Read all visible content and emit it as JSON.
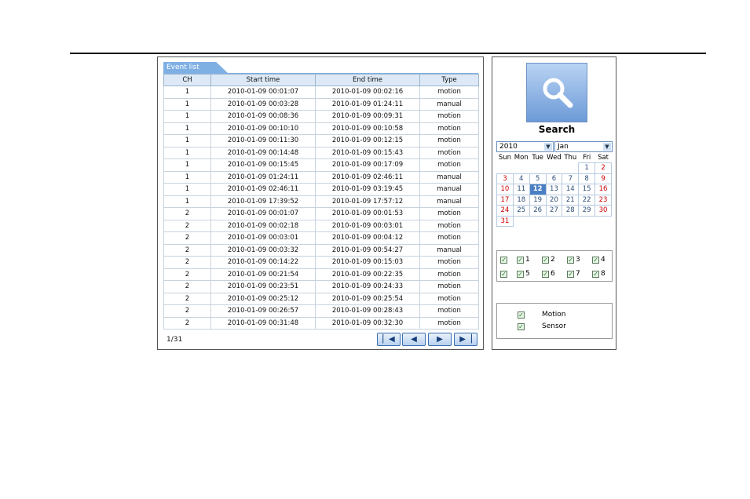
{
  "event_list": {
    "tab_label": "Event list",
    "columns": [
      "CH",
      "Start time",
      "End time",
      "Type"
    ],
    "rows": [
      [
        "1",
        "2010-01-09 00:01:07",
        "2010-01-09 00:02:16",
        "motion"
      ],
      [
        "1",
        "2010-01-09 00:03:28",
        "2010-01-09 01:24:11",
        "manual"
      ],
      [
        "1",
        "2010-01-09 00:08:36",
        "2010-01-09 00:09:31",
        "motion"
      ],
      [
        "1",
        "2010-01-09 00:10:10",
        "2010-01-09 00:10:58",
        "motion"
      ],
      [
        "1",
        "2010-01-09 00:11:30",
        "2010-01-09 00:12:15",
        "motion"
      ],
      [
        "1",
        "2010-01-09 00:14:48",
        "2010-01-09 00:15:43",
        "motion"
      ],
      [
        "1",
        "2010-01-09 00:15:45",
        "2010-01-09 00:17:09",
        "motion"
      ],
      [
        "1",
        "2010-01-09 01:24:11",
        "2010-01-09 02:46:11",
        "manual"
      ],
      [
        "1",
        "2010-01-09 02:46:11",
        "2010-01-09 03:19:45",
        "manual"
      ],
      [
        "1",
        "2010-01-09 17:39:52",
        "2010-01-09 17:57:12",
        "manual"
      ],
      [
        "2",
        "2010-01-09 00:01:07",
        "2010-01-09 00:01:53",
        "motion"
      ],
      [
        "2",
        "2010-01-09 00:02:18",
        "2010-01-09 00:03:01",
        "motion"
      ],
      [
        "2",
        "2010-01-09 00:03:01",
        "2010-01-09 00:04:12",
        "motion"
      ],
      [
        "2",
        "2010-01-09 00:03:32",
        "2010-01-09 00:54:27",
        "manual"
      ],
      [
        "2",
        "2010-01-09 00:14:22",
        "2010-01-09 00:15:03",
        "motion"
      ],
      [
        "2",
        "2010-01-09 00:21:54",
        "2010-01-09 00:22:35",
        "motion"
      ],
      [
        "2",
        "2010-01-09 00:23:51",
        "2010-01-09 00:24:33",
        "motion"
      ],
      [
        "2",
        "2010-01-09 00:25:12",
        "2010-01-09 00:25:54",
        "motion"
      ],
      [
        "2",
        "2010-01-09 00:26:57",
        "2010-01-09 00:28:43",
        "motion"
      ],
      [
        "2",
        "2010-01-09 00:31:48",
        "2010-01-09 00:32:30",
        "motion"
      ]
    ],
    "page_indicator": "1/31",
    "pager": {
      "first": "first-page-icon",
      "prev": "prev-page-icon",
      "next": "next-page-icon",
      "last": "last-page-icon"
    }
  },
  "search": {
    "label": "Search",
    "icon": "magnifier-icon",
    "year": "2010",
    "month": "Jan",
    "selected_day": 12,
    "weekdays": [
      "Sun",
      "Mon",
      "Tue",
      "Wed",
      "Thu",
      "Fri",
      "Sat"
    ],
    "weeks": [
      [
        "",
        "",
        "",
        "",
        "",
        "1",
        "2"
      ],
      [
        "3",
        "4",
        "5",
        "6",
        "7",
        "8",
        "9"
      ],
      [
        "10",
        "11",
        "12",
        "13",
        "14",
        "15",
        "16"
      ],
      [
        "17",
        "18",
        "19",
        "20",
        "21",
        "22",
        "23"
      ],
      [
        "24",
        "25",
        "26",
        "27",
        "28",
        "29",
        "30"
      ],
      [
        "31",
        "",
        "",
        "",
        "",
        "",
        ""
      ]
    ],
    "channels": {
      "all_checked": true,
      "items": [
        {
          "label": "1",
          "checked": true
        },
        {
          "label": "2",
          "checked": true
        },
        {
          "label": "3",
          "checked": true
        },
        {
          "label": "4",
          "checked": true
        },
        {
          "label": "5",
          "checked": true
        },
        {
          "label": "6",
          "checked": true
        },
        {
          "label": "7",
          "checked": true
        },
        {
          "label": "8",
          "checked": true
        }
      ]
    },
    "types": [
      {
        "label": "Motion",
        "checked": true
      },
      {
        "label": "Sensor",
        "checked": true
      }
    ]
  },
  "colors": {
    "accent": "#7fb0e4",
    "header_bg": "#dde9f6",
    "weekend": "#cc0000",
    "selected_day": "#4b7fc4"
  }
}
